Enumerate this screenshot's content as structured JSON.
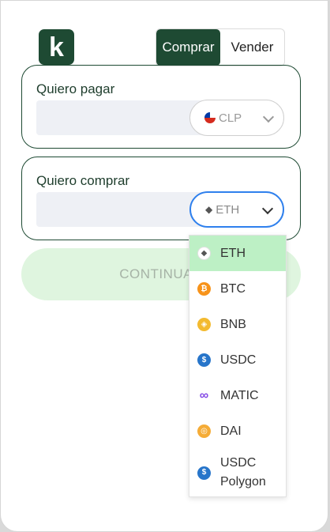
{
  "logo": {
    "letter": "k"
  },
  "toggle": {
    "buy": "Comprar",
    "sell": "Vender"
  },
  "pay": {
    "label": "Quiero pagar",
    "amount": "",
    "currency": "CLP"
  },
  "buy": {
    "label": "Quiero comprar",
    "amount": "",
    "currency": "ETH"
  },
  "continue_label": "CONTINUAR",
  "dropdown": {
    "options": [
      {
        "symbol": "ETH",
        "icon": "eth-icon",
        "color": "#ffffff"
      },
      {
        "symbol": "BTC",
        "icon": "btc-icon",
        "color": "#f7931a"
      },
      {
        "symbol": "BNB",
        "icon": "bnb-icon",
        "color": "#f3ba2f"
      },
      {
        "symbol": "USDC",
        "icon": "usdc-icon",
        "color": "#2775ca"
      },
      {
        "symbol": "MATIC",
        "icon": "matic-icon",
        "color": "#8247e5"
      },
      {
        "symbol": "DAI",
        "icon": "dai-icon",
        "color": "#f5ac37"
      },
      {
        "symbol": "USDC Polygon",
        "icon": "usdc-icon",
        "color": "#2775ca"
      }
    ]
  },
  "colors": {
    "brand": "#1e4a33",
    "focus": "#2f80ed",
    "selected": "#bdf0c5"
  }
}
